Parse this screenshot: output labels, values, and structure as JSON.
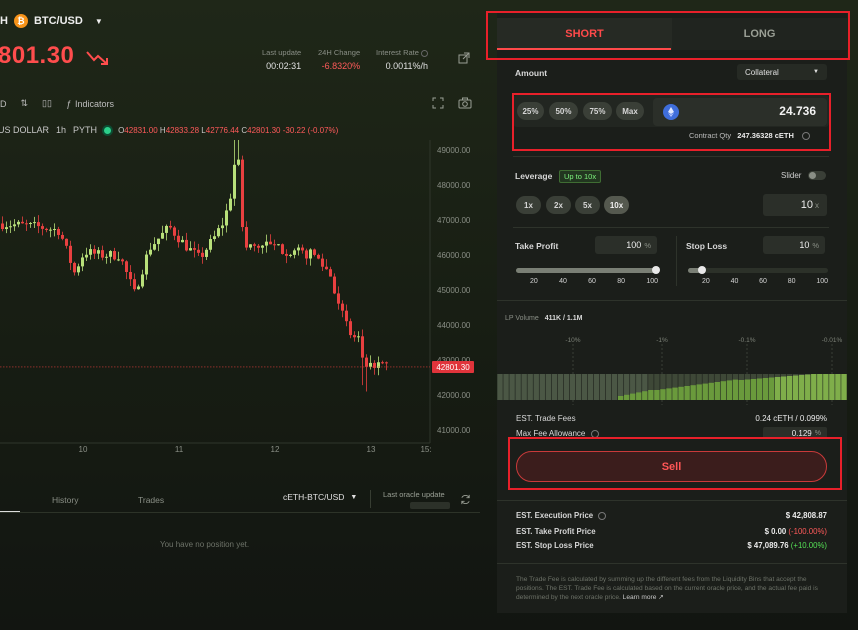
{
  "header": {
    "pair_prefix": "H",
    "pair": "BTC/USD",
    "price": "801.30",
    "stats": [
      {
        "label": "Last update",
        "value": "00:02:31",
        "neg": false
      },
      {
        "label": "24H Change",
        "value": "-6.8320%",
        "neg": true
      },
      {
        "label": "Interest Rate",
        "value": "0.0011%/h",
        "neg": false
      }
    ]
  },
  "toolbar": {
    "interval": "D",
    "indicators_label": "Indicators"
  },
  "legend": {
    "symbol": "US DOLLAR",
    "interval": "1h",
    "source": "PYTH",
    "o_label": "O",
    "o": "42831.00",
    "h_label": "H",
    "h": "42833.28",
    "l_label": "L",
    "l": "42776.44",
    "c_label": "C",
    "c": "42801.30",
    "change": "-30.22 (-0.07%)"
  },
  "chart_data": {
    "type": "candlestick",
    "y_ticks": [
      "49000.00",
      "48000.00",
      "47000.00",
      "46000.00",
      "45000.00",
      "44000.00",
      "43000.00",
      "42000.00",
      "41000.00"
    ],
    "ylim": [
      41000,
      49000
    ],
    "x_ticks": [
      "10",
      "11",
      "12",
      "13",
      "15:"
    ],
    "last_price_label": "42801.30",
    "last_price": 42801.3,
    "colors": {
      "up": "#b8e07a",
      "down": "#e84040"
    }
  },
  "bottom": {
    "tabs": [
      "History",
      "Trades"
    ],
    "market": "cETH-BTC/USD",
    "oracle_label": "Last oracle update",
    "empty_message": "You have no position yet."
  },
  "panel": {
    "tabs": {
      "short": "SHORT",
      "long": "LONG"
    },
    "amount_label": "Amount",
    "collateral_select": "Collateral",
    "pct_buttons": [
      "25%",
      "50%",
      "75%",
      "Max"
    ],
    "amount_value": "24.736",
    "contract_qty_label": "Contract Qty",
    "contract_qty_value": "247.36328 cETH",
    "leverage_label": "Leverage",
    "leverage_badge": "Up to 10x",
    "slider_label": "Slider",
    "leverage_buttons": [
      "1x",
      "2x",
      "5x",
      "10x"
    ],
    "leverage_value": "10",
    "leverage_unit": "x",
    "take_profit_label": "Take Profit",
    "take_profit_value": "100",
    "stop_loss_label": "Stop Loss",
    "stop_loss_value": "10",
    "pct_unit": "%",
    "take_profit_level": 100,
    "stop_loss_level": 10,
    "slider_ticks": [
      "20",
      "40",
      "60",
      "80",
      "100"
    ],
    "lp_volume_label": "LP Volume",
    "lp_volume_value": "411K / 1.1M",
    "lp_ticks": [
      "-10%",
      "-1%",
      "-0.1%",
      "-0.01%"
    ],
    "trade_fees_label": "EST. Trade Fees",
    "trade_fees_value": "0.24 cETH / 0.099%",
    "max_fee_label": "Max Fee Allowance",
    "max_fee_value": "0.129",
    "sell_label": "Sell",
    "est_exec_label": "EST. Execution Price",
    "est_exec_value": "$ 42,808.87",
    "est_tp_label": "EST. Take Profit Price",
    "est_tp_value": "$ 0.00",
    "est_tp_change": "(-100.00%)",
    "est_sl_label": "EST. Stop Loss Price",
    "est_sl_value": "$ 47,089.76",
    "est_sl_change": "(+10.00%)",
    "footnote": "The Trade Fee is calculated by summing up the different fees from the Liquidity Bins that accept the positions. The EST. Trade Fee is calculated based on the current oracle price, and the actual fee paid is determined by the next oracle price.",
    "learn_more": "Learn more"
  }
}
